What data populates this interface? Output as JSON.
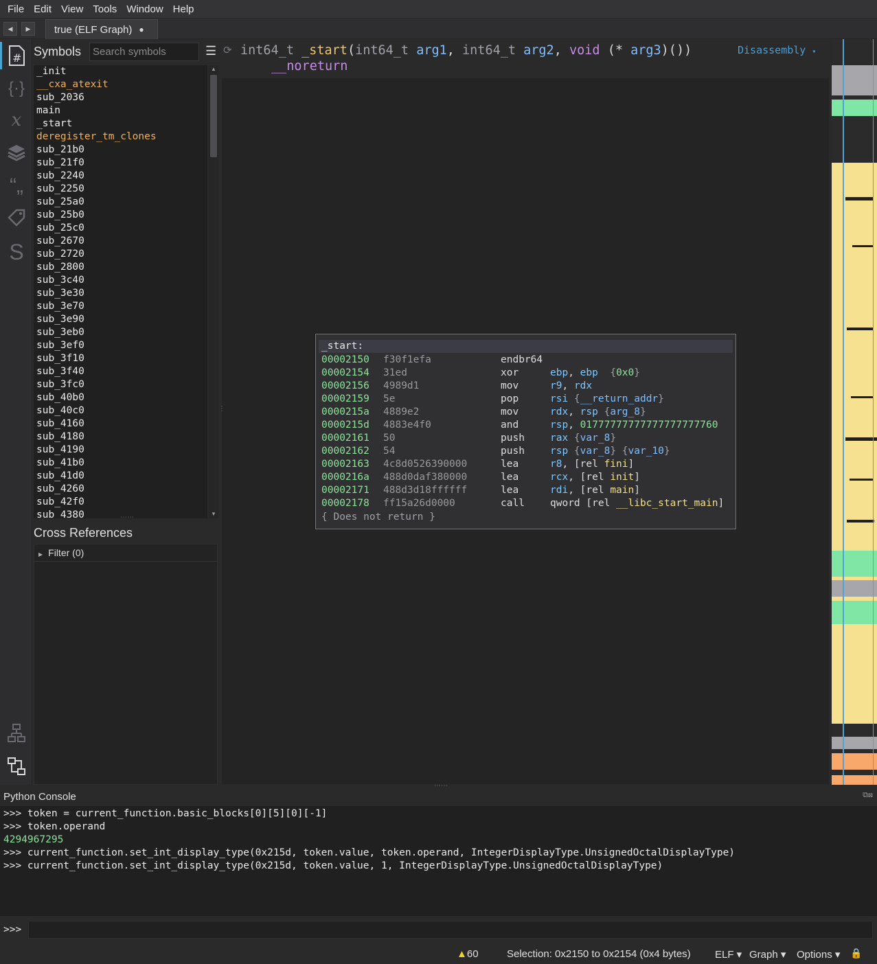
{
  "menu": [
    "File",
    "Edit",
    "View",
    "Tools",
    "Window",
    "Help"
  ],
  "tab": {
    "title": "true (ELF Graph)",
    "modified_marker": "●"
  },
  "sidebar_icons": [
    "symbols-icon",
    "types-icon",
    "variables-icon",
    "stack-icon",
    "strings-icon",
    "tags-icon",
    "stack-view-icon",
    "graph-icon",
    "xref-icon"
  ],
  "symbols": {
    "title": "Symbols",
    "search_placeholder": "Search symbols",
    "items": [
      {
        "name": "_init",
        "kind": "func"
      },
      {
        "name": "__cxa_atexit",
        "kind": "import"
      },
      {
        "name": "sub_2036",
        "kind": "func"
      },
      {
        "name": "main",
        "kind": "func"
      },
      {
        "name": "_start",
        "kind": "func"
      },
      {
        "name": "deregister_tm_clones",
        "kind": "import"
      },
      {
        "name": "sub_21b0",
        "kind": "func"
      },
      {
        "name": "sub_21f0",
        "kind": "func"
      },
      {
        "name": "sub_2240",
        "kind": "func"
      },
      {
        "name": "sub_2250",
        "kind": "func"
      },
      {
        "name": "sub_25a0",
        "kind": "func"
      },
      {
        "name": "sub_25b0",
        "kind": "func"
      },
      {
        "name": "sub_25c0",
        "kind": "func"
      },
      {
        "name": "sub_2670",
        "kind": "func"
      },
      {
        "name": "sub_2720",
        "kind": "func"
      },
      {
        "name": "sub_2800",
        "kind": "func"
      },
      {
        "name": "sub_3c40",
        "kind": "func"
      },
      {
        "name": "sub_3e30",
        "kind": "func"
      },
      {
        "name": "sub_3e70",
        "kind": "func"
      },
      {
        "name": "sub_3e90",
        "kind": "func"
      },
      {
        "name": "sub_3eb0",
        "kind": "func"
      },
      {
        "name": "sub_3ef0",
        "kind": "func"
      },
      {
        "name": "sub_3f10",
        "kind": "func"
      },
      {
        "name": "sub_3f40",
        "kind": "func"
      },
      {
        "name": "sub_3fc0",
        "kind": "func"
      },
      {
        "name": "sub_40b0",
        "kind": "func"
      },
      {
        "name": "sub_40c0",
        "kind": "func"
      },
      {
        "name": "sub_4160",
        "kind": "func"
      },
      {
        "name": "sub_4180",
        "kind": "func"
      },
      {
        "name": "sub_4190",
        "kind": "func"
      },
      {
        "name": "sub_41b0",
        "kind": "func"
      },
      {
        "name": "sub_41d0",
        "kind": "func"
      },
      {
        "name": "sub_4260",
        "kind": "func"
      },
      {
        "name": "sub_42f0",
        "kind": "func"
      },
      {
        "name": "sub_4380",
        "kind": "func"
      }
    ]
  },
  "xrefs": {
    "title": "Cross References",
    "filter_label": "Filter (0)"
  },
  "function_header": {
    "ret_type": "int64_t",
    "name": "_start",
    "p1_type": "int64_t",
    "p1": "arg1",
    "p2_type": "int64_t",
    "p2": "arg2",
    "p3_type": "void",
    "p3_ptr": "(*",
    "p3": "arg3",
    "p3_tail": ")())",
    "attr": "__noreturn",
    "view_selector": "Disassembly"
  },
  "block": {
    "label": "_start:",
    "instructions": [
      {
        "addr": "00002150",
        "bytes": "f30f1efa",
        "mnemonic": "endbr64",
        "ops": []
      },
      {
        "addr": "00002154",
        "bytes": "31ed",
        "mnemonic": "xor",
        "ops": [
          {
            "t": "ebp",
            "c": "reg"
          },
          {
            "t": ", ",
            "c": "p"
          },
          {
            "t": "ebp",
            "c": "reg"
          },
          {
            "t": "  {",
            "c": "brace"
          },
          {
            "t": "0x0",
            "c": "num"
          },
          {
            "t": "}",
            "c": "brace"
          }
        ]
      },
      {
        "addr": "00002156",
        "bytes": "4989d1",
        "mnemonic": "mov",
        "ops": [
          {
            "t": "r9",
            "c": "reg"
          },
          {
            "t": ", ",
            "c": "p"
          },
          {
            "t": "rdx",
            "c": "reg"
          }
        ]
      },
      {
        "addr": "00002159",
        "bytes": "5e",
        "mnemonic": "pop",
        "ops": [
          {
            "t": "rsi",
            "c": "reg"
          },
          {
            "t": " {",
            "c": "brace"
          },
          {
            "t": "__return_addr",
            "c": "var"
          },
          {
            "t": "}",
            "c": "brace"
          }
        ]
      },
      {
        "addr": "0000215a",
        "bytes": "4889e2",
        "mnemonic": "mov",
        "ops": [
          {
            "t": "rdx",
            "c": "reg"
          },
          {
            "t": ", ",
            "c": "p"
          },
          {
            "t": "rsp",
            "c": "reg"
          },
          {
            "t": " {",
            "c": "brace"
          },
          {
            "t": "arg_8",
            "c": "var"
          },
          {
            "t": "}",
            "c": "brace"
          }
        ]
      },
      {
        "addr": "0000215d",
        "bytes": "4883e4f0",
        "mnemonic": "and",
        "ops": [
          {
            "t": "rsp",
            "c": "reg"
          },
          {
            "t": ", ",
            "c": "p"
          },
          {
            "t": "01777777777777777777760",
            "c": "num"
          }
        ]
      },
      {
        "addr": "00002161",
        "bytes": "50",
        "mnemonic": "push",
        "ops": [
          {
            "t": "rax",
            "c": "reg"
          },
          {
            "t": " {",
            "c": "brace"
          },
          {
            "t": "var_8",
            "c": "var"
          },
          {
            "t": "}",
            "c": "brace"
          }
        ]
      },
      {
        "addr": "00002162",
        "bytes": "54",
        "mnemonic": "push",
        "ops": [
          {
            "t": "rsp",
            "c": "reg"
          },
          {
            "t": " {",
            "c": "brace"
          },
          {
            "t": "var_8",
            "c": "var"
          },
          {
            "t": "} {",
            "c": "brace"
          },
          {
            "t": "var_10",
            "c": "var"
          },
          {
            "t": "}",
            "c": "brace"
          }
        ]
      },
      {
        "addr": "00002163",
        "bytes": "4c8d0526390000",
        "mnemonic": "lea",
        "ops": [
          {
            "t": "r8",
            "c": "reg"
          },
          {
            "t": ", [rel ",
            "c": "p"
          },
          {
            "t": "fini",
            "c": "sym"
          },
          {
            "t": "]",
            "c": "p"
          }
        ]
      },
      {
        "addr": "0000216a",
        "bytes": "488d0daf380000",
        "mnemonic": "lea",
        "ops": [
          {
            "t": "rcx",
            "c": "reg"
          },
          {
            "t": ", [rel ",
            "c": "p"
          },
          {
            "t": "init",
            "c": "sym"
          },
          {
            "t": "]",
            "c": "p"
          }
        ]
      },
      {
        "addr": "00002171",
        "bytes": "488d3d18ffffff",
        "mnemonic": "lea",
        "ops": [
          {
            "t": "rdi",
            "c": "reg"
          },
          {
            "t": ", [rel ",
            "c": "p"
          },
          {
            "t": "main",
            "c": "sym"
          },
          {
            "t": "]",
            "c": "p"
          }
        ]
      },
      {
        "addr": "00002178",
        "bytes": "ff15a26d0000",
        "mnemonic": "call",
        "ops": [
          {
            "t": "qword [rel ",
            "c": "p"
          },
          {
            "t": "__libc_start_main",
            "c": "sym"
          },
          {
            "t": "]",
            "c": "p"
          }
        ]
      }
    ],
    "footer": "{ Does not return }"
  },
  "console": {
    "title": "Python Console",
    "lines": [
      {
        "text": ">>> token = current_function.basic_blocks[0][5][0][-1]",
        "kind": "input"
      },
      {
        "text": ">>> token.operand",
        "kind": "input"
      },
      {
        "text": "4294967295",
        "kind": "result"
      },
      {
        "text": ">>> current_function.set_int_display_type(0x215d, token.value, token.operand, IntegerDisplayType.UnsignedOctalDisplayType)",
        "kind": "input"
      },
      {
        "text": ">>> current_function.set_int_display_type(0x215d, token.value, 1, IntegerDisplayType.UnsignedOctalDisplayType)",
        "kind": "input"
      }
    ],
    "prompt": ">>>",
    "input_value": ""
  },
  "status": {
    "warning_count": "60",
    "selection": "Selection: 0x2150 to 0x2154 (0x4 bytes)",
    "platform": "ELF ▾",
    "view": "Graph ▾",
    "options": "Options ▾"
  },
  "colors": {
    "address": "#8ee39a",
    "register": "#7ec8ff",
    "import_symbol": "#f0b05a",
    "accent": "#4a9fd6",
    "warning": "#f2d22a"
  }
}
